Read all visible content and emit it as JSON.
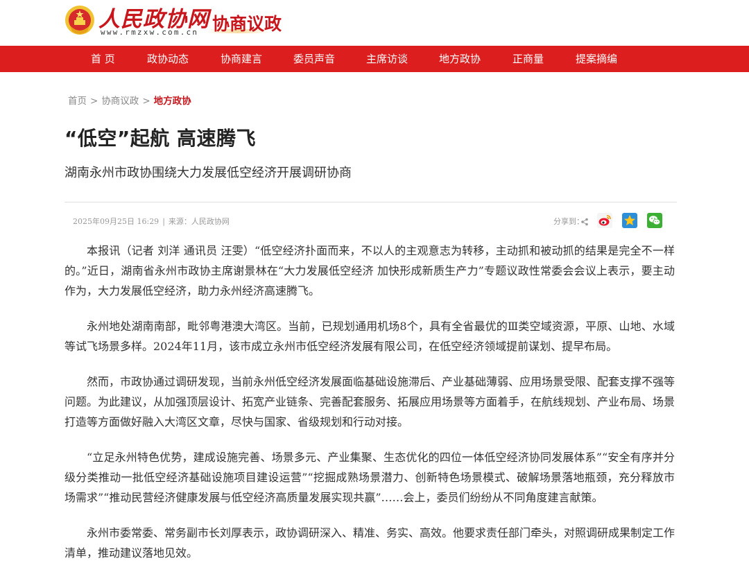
{
  "site": {
    "name": "人民政协网",
    "url": "www.rmzxw.com.cn",
    "section": "协商议政",
    "colors": {
      "brand_red": "#dc1e1e",
      "title_red": "#c8161d",
      "gold": "#e6b450"
    }
  },
  "nav": {
    "items": [
      {
        "label": "首 页"
      },
      {
        "label": "政协动态"
      },
      {
        "label": "协商建言"
      },
      {
        "label": "委员声音"
      },
      {
        "label": "主席访谈"
      },
      {
        "label": "地方政协"
      },
      {
        "label": "正商量"
      },
      {
        "label": "提案摘编"
      }
    ]
  },
  "breadcrumb": {
    "home": "首页",
    "sep": ">",
    "section": "协商议政",
    "current": "地方政协"
  },
  "article": {
    "title": "“低空”起航 高速腾飞",
    "subtitle": "湖南永州市政协围绕大力发展低空经济开展调研协商",
    "datetime": "2025年09月25日 16:29",
    "meta_sep": "|",
    "source": "来源：人民政协网",
    "share_label": "分享到：",
    "share_icons": [
      "share-icon",
      "weibo-icon",
      "qzone-icon",
      "wechat-icon"
    ],
    "paragraphs": [
      "本报讯（记者 刘洋 通讯员 汪雯）“低空经济扑面而来，不以人的主观意志为转移，主动抓和被动抓的结果是完全不一样的。”近日，湖南省永州市政协主席谢景林在“大力发展低空经济 加快形成新质生产力”专题议政性常委会会议上表示，要主动作为，大力发展低空经济，助力永州经济高速腾飞。",
      "永州地处湖南南部，毗邻粤港澳大湾区。当前，已规划通用机场8个，具有全省最优的Ⅲ类空域资源，平原、山地、水域等试飞场景多样。2024年11月，该市成立永州市低空经济发展有限公司，在低空经济领域提前谋划、提早布局。",
      "然而，市政协通过调研发现，当前永州低空经济发展面临基础设施滞后、产业基础薄弱、应用场景受限、配套支撑不强等问题。为此建议，从加强顶层设计、拓宽产业链条、完善配套服务、拓展应用场景等方面着手，在航线规划、产业布局、场景打造等方面做好融入大湾区文章，尽快与国家、省级规划和行动对接。",
      "“立足永州特色优势，建成设施完善、场景多元、产业集聚、生态优化的四位一体低空经济协同发展体系”“安全有序并分级分类推动一批低空经济基础设施项目建设运营”“挖掘成熟场景潜力、创新特色场景模式、破解场景落地瓶颈，充分释放市场需求”“推动民营经济健康发展与低空经济高质量发展实现共赢”……会上，委员们纷纷从不同角度建言献策。",
      "永州市委常委、常务副市长刘厚表示，政协调研深入、精准、务实、高效。他要求责任部门牵头，对照调研成果制定工作清单，推动建议落地见效。"
    ]
  }
}
